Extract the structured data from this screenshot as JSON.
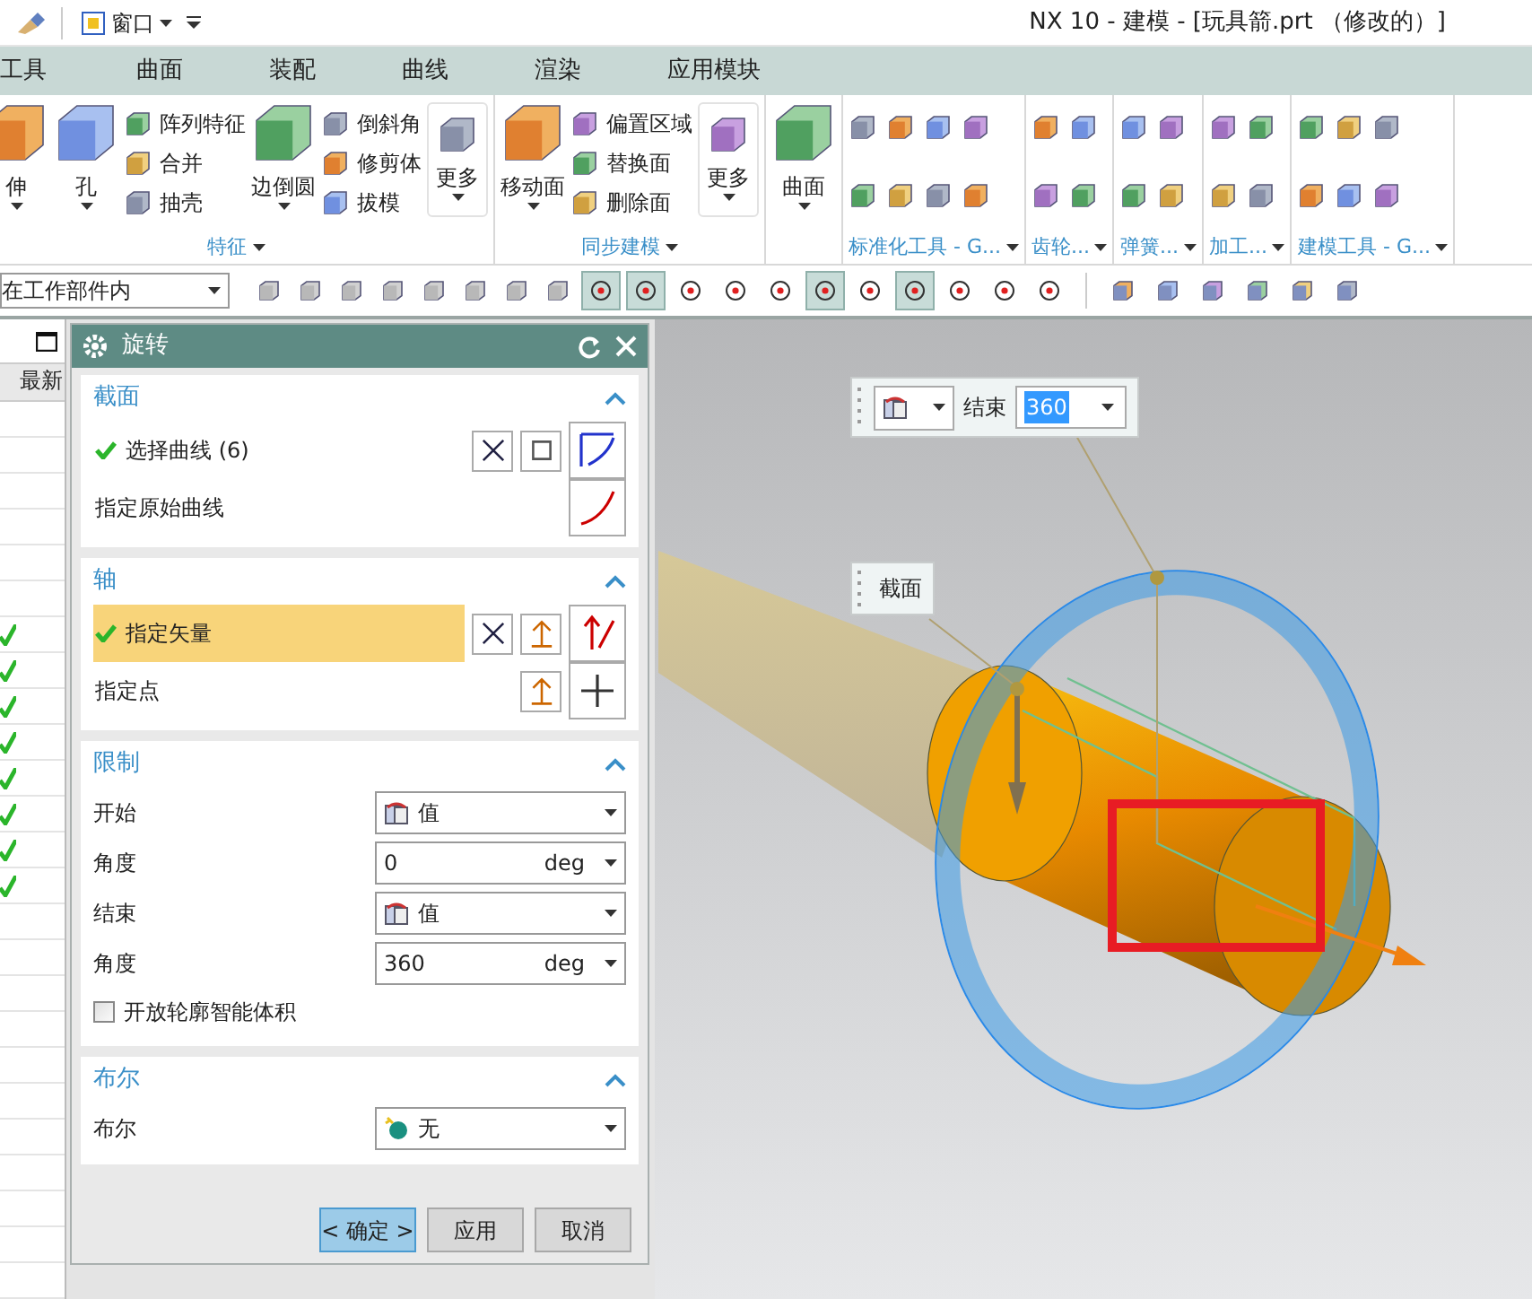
{
  "window_title": "NX 10 - 建模 - [玩具箭.prt （修改的）]",
  "quick_access": {
    "menu": "窗口"
  },
  "menu_tabs": [
    "工具",
    "曲面",
    "装配",
    "曲线",
    "渲染",
    "应用模块"
  ],
  "ribbon_groups": [
    {
      "label": "特征",
      "items": [
        {
          "kind": "large",
          "label": "伸"
        },
        {
          "kind": "large",
          "label": "孔"
        },
        {
          "kind": "small_column",
          "labels": [
            "阵列特征",
            "合并",
            "抽壳"
          ]
        },
        {
          "kind": "large",
          "label": "边倒圆"
        },
        {
          "kind": "small_column",
          "labels": [
            "倒斜角",
            "修剪体",
            "拔模"
          ]
        },
        {
          "kind": "more",
          "label": "更多"
        }
      ]
    },
    {
      "label": "同步建模",
      "items": [
        {
          "kind": "large",
          "label": "移动面"
        },
        {
          "kind": "small_column",
          "labels": [
            "偏置区域",
            "替换面",
            "删除面"
          ]
        },
        {
          "kind": "more",
          "label": "更多"
        }
      ]
    },
    {
      "items": [
        {
          "kind": "large",
          "label": "曲面"
        }
      ]
    },
    {
      "label": "标准化工具 - G...",
      "items": [
        {
          "kind": "icon_grid_wide"
        }
      ]
    },
    {
      "label": "齿轮...",
      "items": [
        {
          "kind": "icon_grid_narrow"
        }
      ]
    },
    {
      "label": "弹簧...",
      "items": [
        {
          "kind": "icon_grid_narrow"
        }
      ]
    },
    {
      "label": "加工...",
      "items": [
        {
          "kind": "icon_grid_narrow"
        }
      ]
    },
    {
      "label": "建模工具 - G...",
      "items": [
        {
          "kind": "icon_grid_medium"
        }
      ]
    }
  ],
  "selection_bar": {
    "filter": "在工作部件内",
    "snap_buttons": [
      {
        "pressed": true
      },
      {
        "pressed": true
      },
      {
        "pressed": false
      },
      {
        "pressed": false
      },
      {
        "pressed": false
      },
      {
        "pressed": true
      },
      {
        "pressed": false
      },
      {
        "pressed": true
      },
      {
        "pressed": false
      },
      {
        "pressed": false
      },
      {
        "pressed": false
      }
    ]
  },
  "part_navigator": {
    "column": "最新",
    "rows": [
      {
        "checked": false
      },
      {
        "checked": false
      },
      {
        "checked": false
      },
      {
        "checked": false
      },
      {
        "checked": false
      },
      {
        "checked": false
      },
      {
        "checked": true
      },
      {
        "checked": true
      },
      {
        "checked": true
      },
      {
        "checked": true
      },
      {
        "checked": true
      },
      {
        "checked": true
      },
      {
        "checked": true
      },
      {
        "checked": true
      },
      {
        "checked": false
      },
      {
        "checked": false
      },
      {
        "checked": false
      },
      {
        "checked": false
      },
      {
        "checked": false
      },
      {
        "checked": false
      },
      {
        "checked": false
      },
      {
        "checked": false
      },
      {
        "checked": false
      },
      {
        "checked": false
      },
      {
        "checked": false
      }
    ]
  },
  "dialog": {
    "title": "旋转",
    "sections": [
      {
        "title": "截面",
        "expanded": true,
        "rows": [
          {
            "kind": "selection",
            "label": "选择曲线 (6)",
            "done": true,
            "highlighted": false
          },
          {
            "kind": "selection",
            "label": "指定原始曲线",
            "done": false,
            "highlighted": false
          }
        ]
      },
      {
        "title": "轴",
        "expanded": true,
        "rows": [
          {
            "kind": "selection",
            "label": "指定矢量",
            "done": true,
            "highlighted": true
          },
          {
            "kind": "selection",
            "label": "指定点",
            "done": false,
            "highlighted": false
          }
        ]
      },
      {
        "title": "限制",
        "expanded": true,
        "rows": [
          {
            "kind": "dropdown",
            "label": "开始",
            "value": "值"
          },
          {
            "kind": "number",
            "label": "角度",
            "value": "0",
            "unit": "deg"
          },
          {
            "kind": "dropdown",
            "label": "结束",
            "value": "值"
          },
          {
            "kind": "number",
            "label": "角度",
            "value": "360",
            "unit": "deg"
          },
          {
            "kind": "checkbox",
            "label": "开放轮廓智能体积",
            "checked": false
          }
        ]
      },
      {
        "title": "布尔",
        "expanded": true,
        "rows": [
          {
            "kind": "boolean",
            "label": "布尔",
            "value": "无"
          }
        ]
      }
    ],
    "buttons": [
      {
        "label": "< 确定 >",
        "default": true
      },
      {
        "label": "应用",
        "default": false
      },
      {
        "label": "取消",
        "default": false
      }
    ]
  },
  "viewport": {
    "end_label": "结束",
    "end_value": "360",
    "section_label": "截面"
  }
}
